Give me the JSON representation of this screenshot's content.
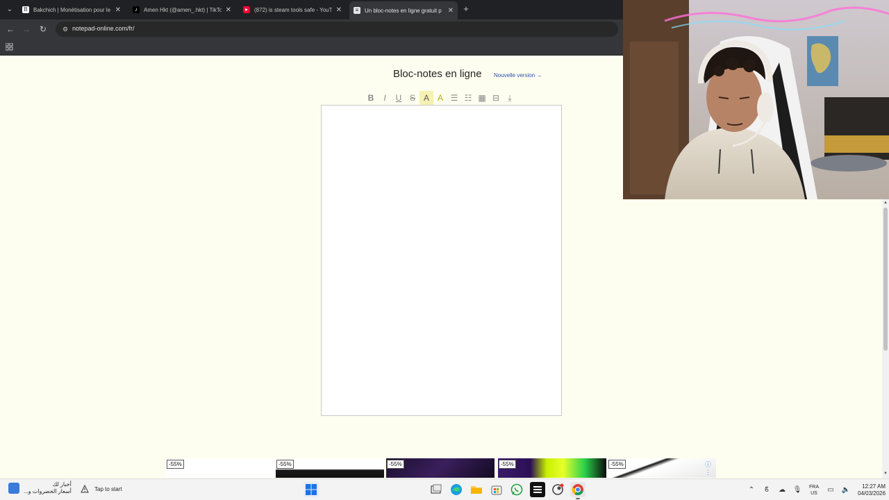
{
  "browser": {
    "tabs": [
      {
        "title": "Bakchich | Monétisation pour le",
        "favicon": "bakchich-favicon",
        "active": false
      },
      {
        "title": "Amen Hkt (@amen_.hkt) | TikTo",
        "favicon": "tiktok-favicon",
        "active": false
      },
      {
        "title": "(872) is steam tools safe - YouT",
        "favicon": "youtube-favicon",
        "active": false
      },
      {
        "title": "Un bloc-notes en ligne gratuit p",
        "favicon": "notepad-favicon",
        "active": true
      }
    ],
    "close_glyph": "✕",
    "new_tab_glyph": "+",
    "url": "notepad-online.com/fr/"
  },
  "page": {
    "title": "Bloc-notes en ligne",
    "new_version_link": "Nouvelle version →",
    "format_buttons": [
      {
        "name": "bold-button",
        "glyph": "B"
      },
      {
        "name": "italic-button",
        "glyph": "I"
      },
      {
        "name": "underline-button",
        "glyph": "U"
      },
      {
        "name": "strikethrough-button",
        "glyph": "S"
      },
      {
        "name": "highlight-color-button",
        "glyph": "A"
      },
      {
        "name": "font-color-button",
        "glyph": "A"
      },
      {
        "name": "bullet-list-button",
        "glyph": "☰"
      },
      {
        "name": "numbered-list-button",
        "glyph": "☷"
      },
      {
        "name": "insert-table-button",
        "glyph": "▦"
      },
      {
        "name": "horizontal-rule-button",
        "glyph": "⊟"
      },
      {
        "name": "download-button",
        "glyph": "⤓"
      }
    ],
    "editor_content": ""
  },
  "ads": [
    {
      "discount": "-55%"
    },
    {
      "discount": "-55%"
    },
    {
      "discount": "-55%"
    },
    {
      "discount": "-55%"
    },
    {
      "discount": "-55%"
    }
  ],
  "taskbar": {
    "widget_line1": "أخبار لك",
    "widget_line2": "أسعار الخضروات و...",
    "tap_to_start": "Tap to start",
    "lang_line1": "FRA",
    "lang_line2": "US",
    "time": "12:27 AM",
    "date": "04/03/2026"
  },
  "colors": {
    "page_background": "#fefef0",
    "tab_strip": "#202124",
    "toolbar": "#35363a",
    "link": "#2a4fa8"
  }
}
